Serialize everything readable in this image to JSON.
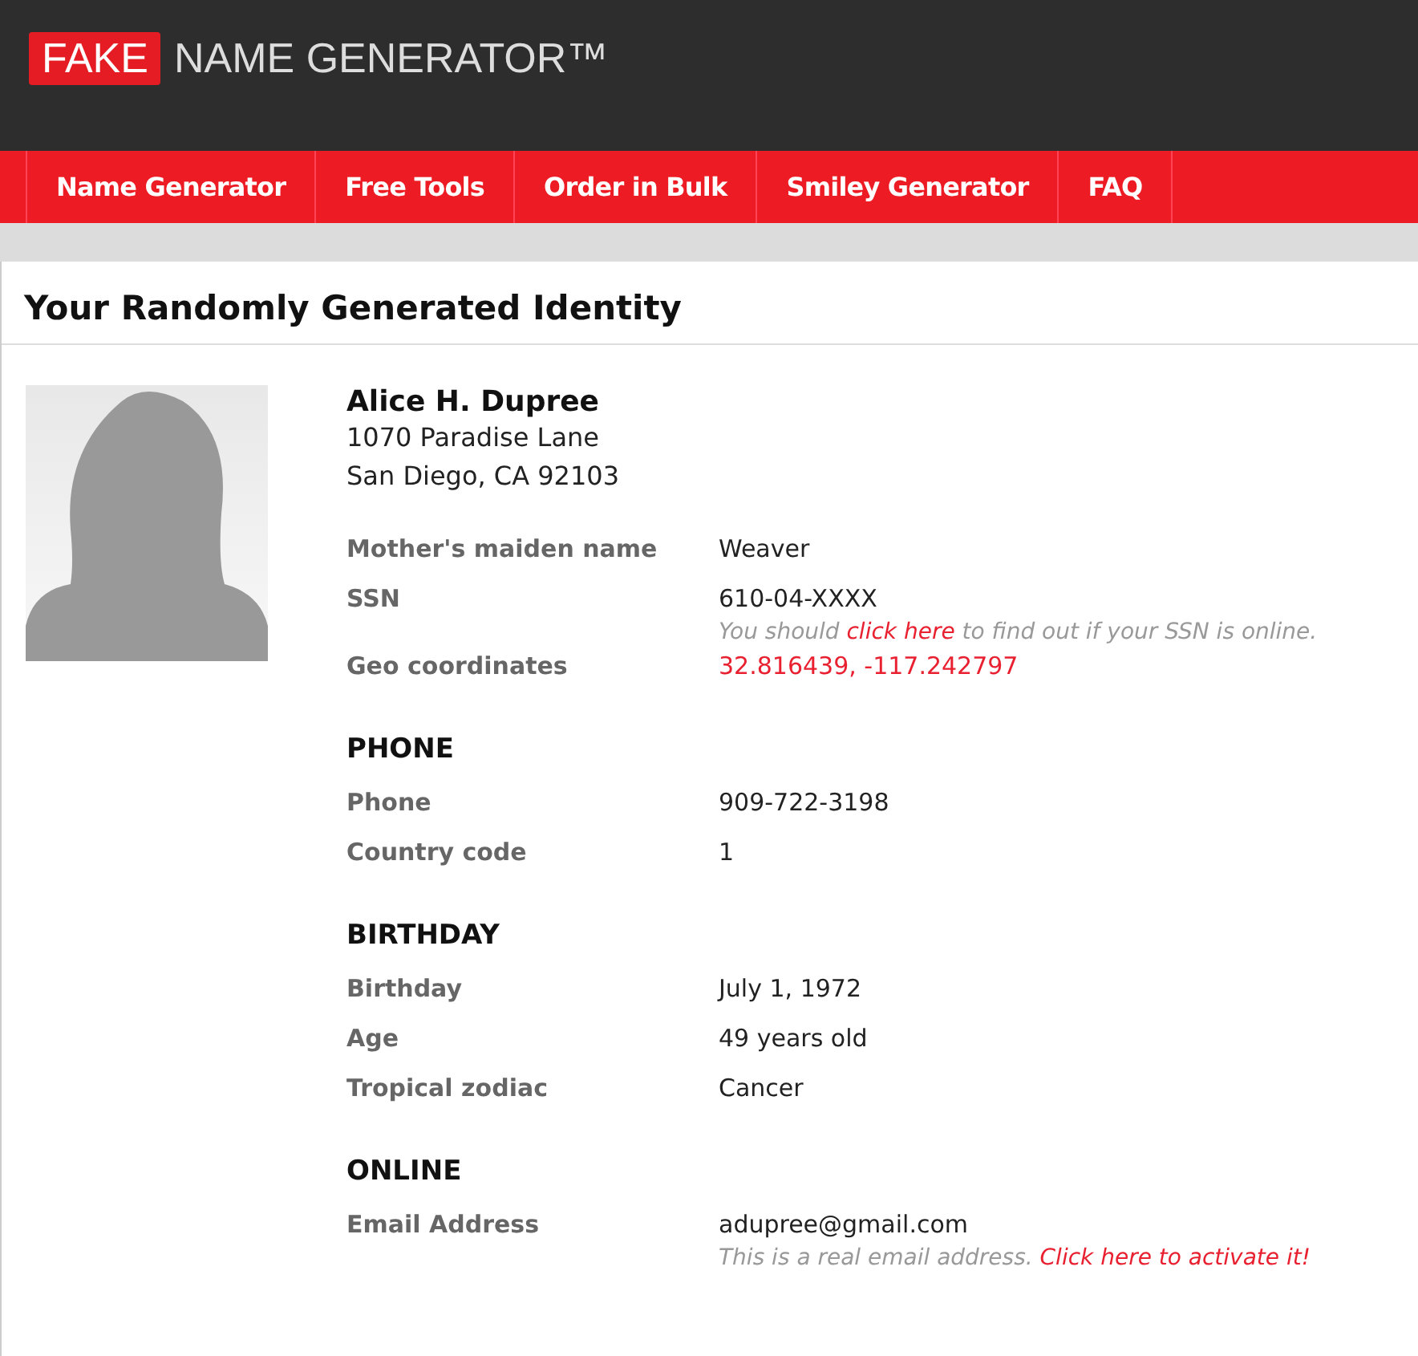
{
  "logo": {
    "badge": "FAKE",
    "text": "NAME GENERATOR™"
  },
  "nav": [
    {
      "label": "Name Generator"
    },
    {
      "label": "Free Tools"
    },
    {
      "label": "Order in Bulk"
    },
    {
      "label": "Smiley Generator"
    },
    {
      "label": "FAQ"
    }
  ],
  "page_title": "Your Randomly Generated Identity",
  "identity": {
    "name": "Alice H. Dupree",
    "address_lines": [
      "1070 Paradise Lane",
      "San Diego, CA 92103"
    ]
  },
  "sections": [
    {
      "rows": [
        {
          "label": "Mother's maiden name",
          "value": "Weaver",
          "kind": "text"
        },
        {
          "label": "SSN",
          "value": "610-04-XXXX",
          "kind": "text",
          "note": [
            {
              "text": "You should ",
              "link": false
            },
            {
              "text": "click here",
              "link": true
            },
            {
              "text": " to find out if your SSN is online.",
              "link": false
            }
          ]
        },
        {
          "label": "Geo coordinates",
          "value": "32.816439, -117.242797",
          "kind": "link"
        }
      ]
    },
    {
      "heading": "PHONE",
      "rows": [
        {
          "label": "Phone",
          "value": "909-722-3198",
          "kind": "text"
        },
        {
          "label": "Country code",
          "value": "1",
          "kind": "text"
        }
      ]
    },
    {
      "heading": "BIRTHDAY",
      "rows": [
        {
          "label": "Birthday",
          "value": "July 1, 1972",
          "kind": "text"
        },
        {
          "label": "Age",
          "value": "49 years old",
          "kind": "text"
        },
        {
          "label": "Tropical zodiac",
          "value": "Cancer",
          "kind": "text"
        }
      ]
    },
    {
      "heading": "ONLINE",
      "rows": [
        {
          "label": "Email Address",
          "value": "adupree@gmail.com",
          "kind": "text",
          "note": [
            {
              "text": "This is a real email address. ",
              "link": false
            },
            {
              "text": "Click here to activate it!",
              "link": true
            }
          ]
        }
      ]
    }
  ]
}
